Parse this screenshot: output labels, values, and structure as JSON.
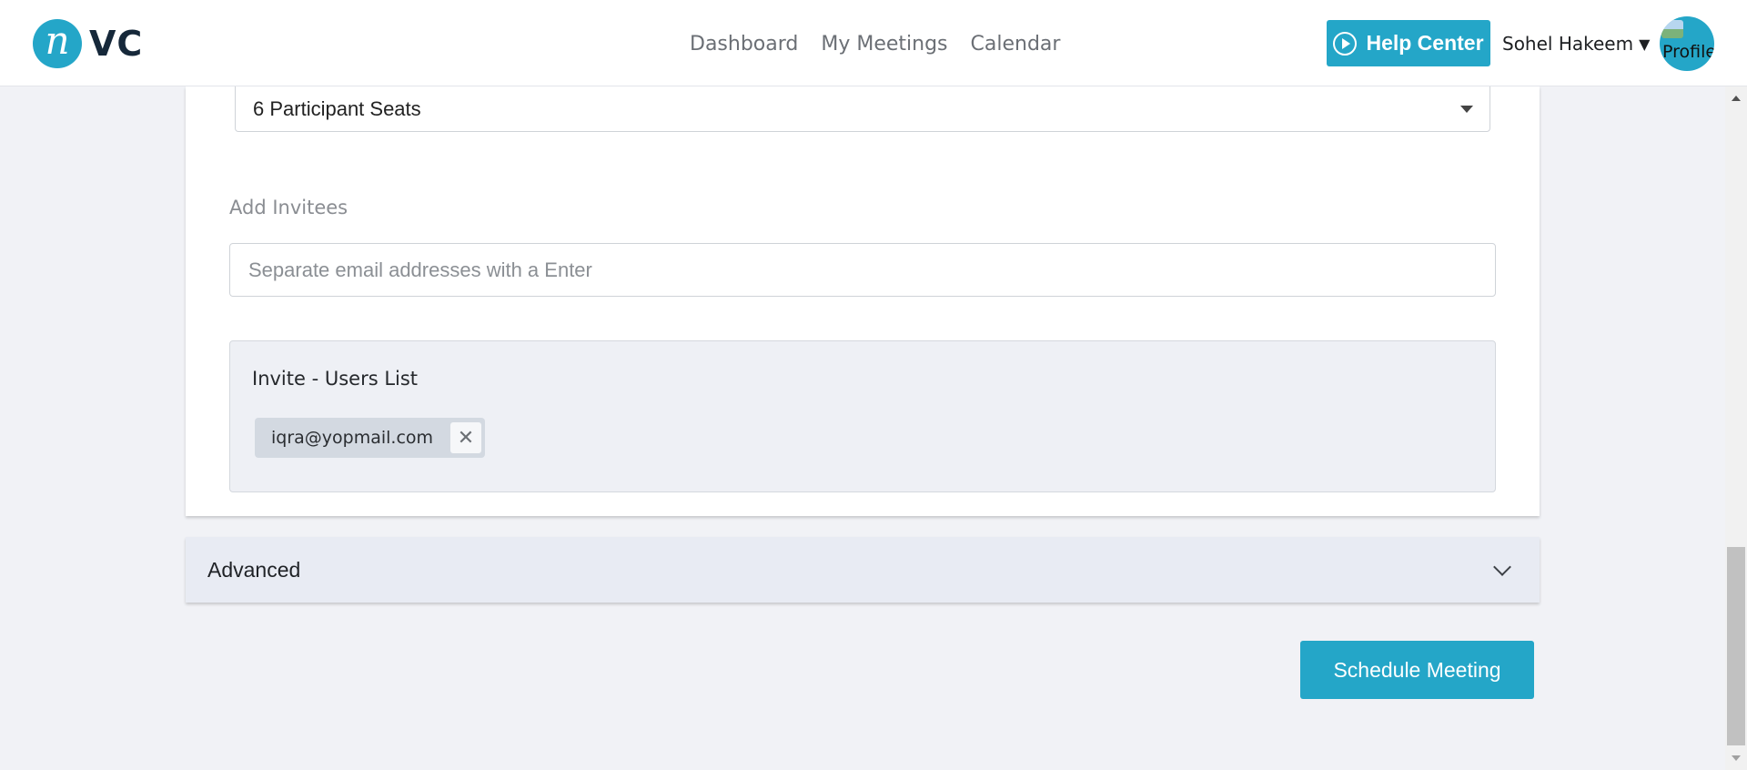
{
  "header": {
    "logo_text": "VC",
    "logo_mark": "n",
    "nav": [
      "Dashboard",
      "My Meetings",
      "Calendar"
    ],
    "help_label": "Help Center",
    "user_name": "Sohel Hakeem",
    "avatar_alt": "Profile"
  },
  "form": {
    "seats_value": "6 Participant Seats",
    "invitees_label": "Add Invitees",
    "invitees_placeholder": "Separate email addresses with a Enter",
    "users_list_title": "Invite - Users List",
    "invited": [
      "iqra@yopmail.com"
    ]
  },
  "advanced_label": "Advanced",
  "schedule_label": "Schedule Meeting",
  "colors": {
    "accent": "#24a6c8",
    "background": "#f1f2f6",
    "advanced_bg": "#e8ebf3",
    "chip_bg": "#d3d9e1"
  },
  "icons": {
    "help": "play-circle-icon",
    "user_menu": "caret-down-icon",
    "select": "select-caret-icon",
    "chip_remove": "close-icon",
    "accordion": "chevron-down-icon"
  }
}
